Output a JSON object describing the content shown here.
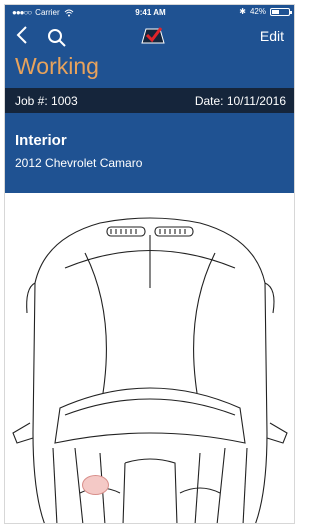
{
  "status_bar": {
    "carrier": "Carrier",
    "time": "9:41 AM",
    "battery": "42%",
    "battery_level": 0.42
  },
  "nav": {
    "back_icon": "chevron-left-icon",
    "search_icon": "search-icon",
    "logo_icon": "app-logo-icon",
    "edit_label": "Edit"
  },
  "header": {
    "title": "Working"
  },
  "job_bar": {
    "job": "Job #: 1003",
    "date": "Date: 10/11/2016"
  },
  "section": {
    "name": "Interior",
    "vehicle": "2012 Chevrolet Camaro"
  },
  "colors": {
    "header_blue": "#1f5292",
    "job_bar_navy": "#15253b",
    "title_orange": "#e8a35c",
    "marker_pink": "#f4c9c6"
  }
}
